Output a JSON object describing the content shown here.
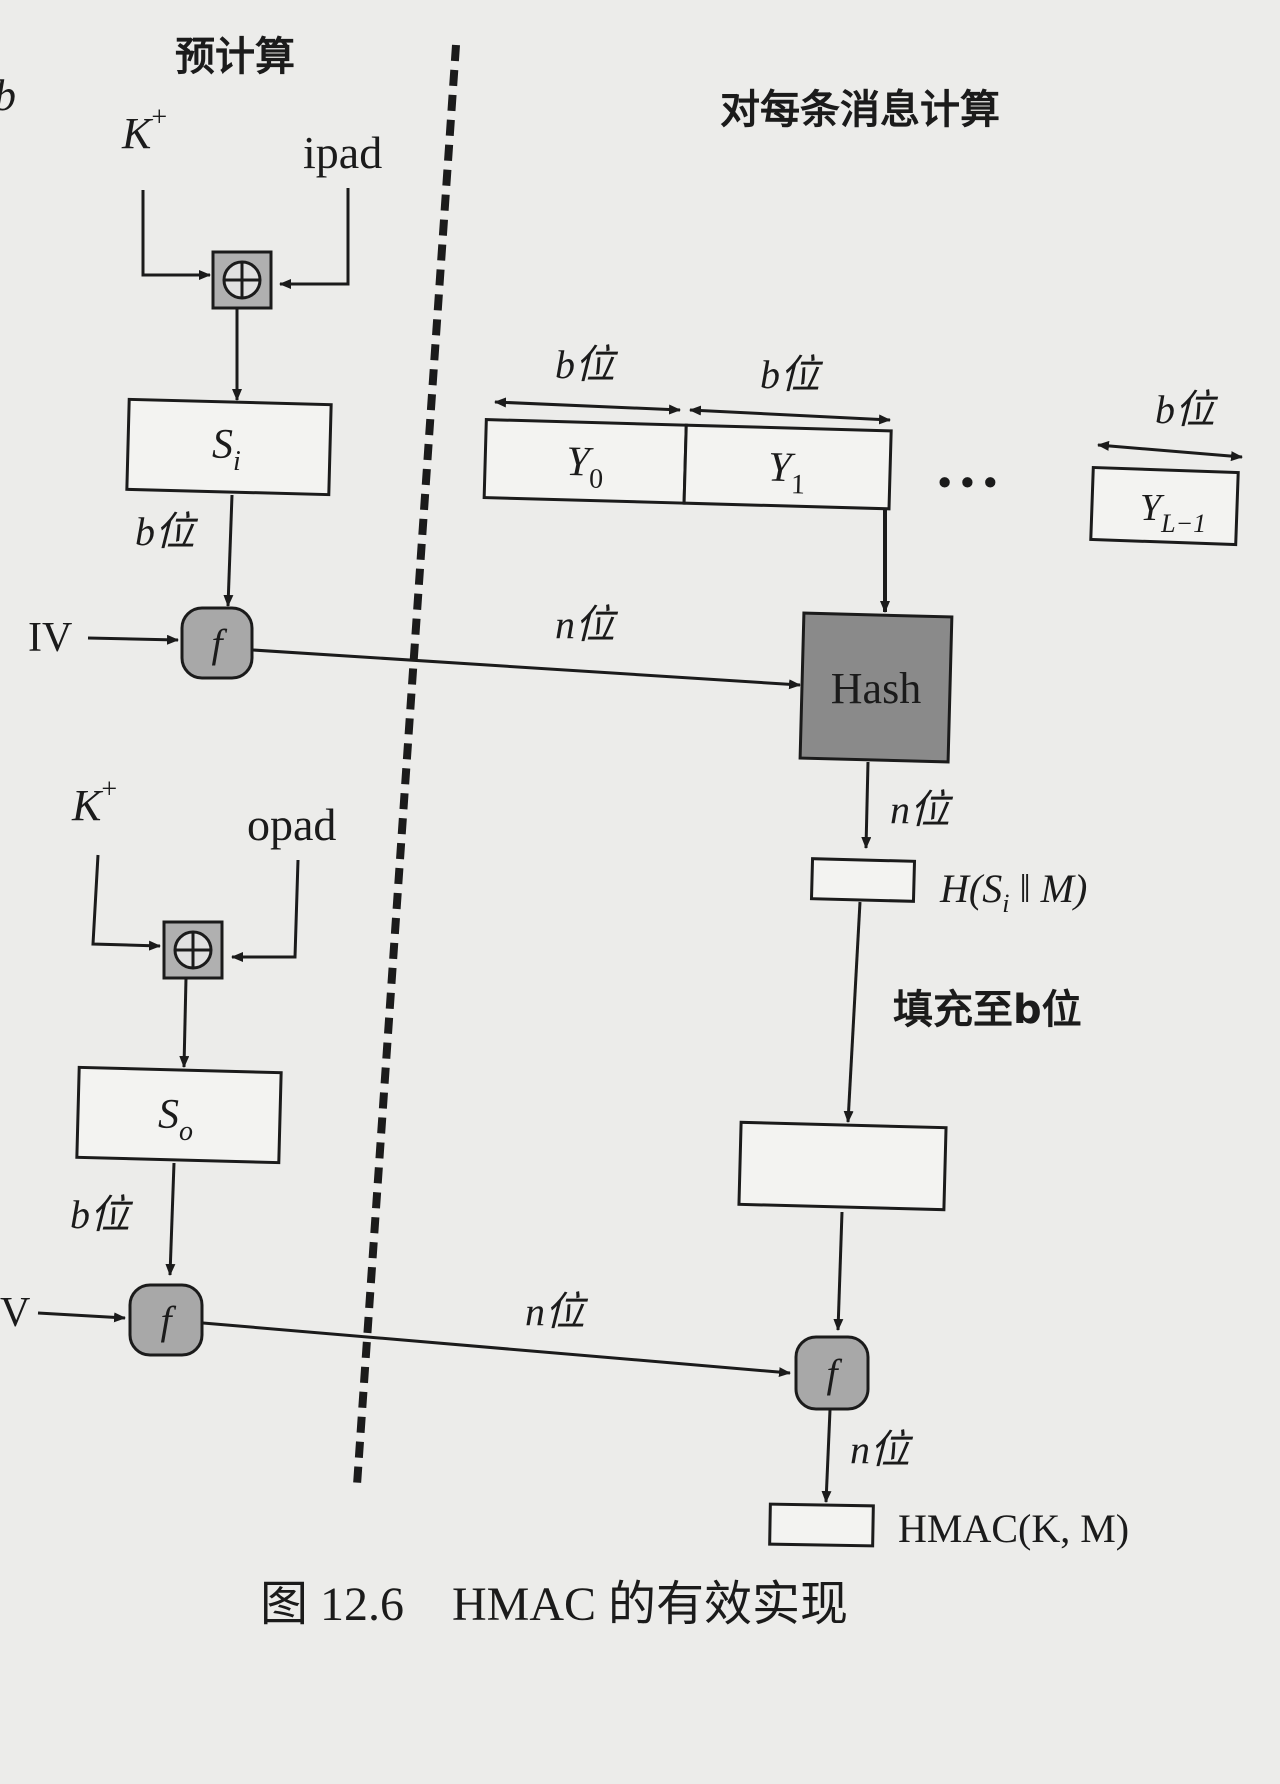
{
  "sections": {
    "precompute": "预计算",
    "per_message": "对每条消息计算"
  },
  "inputs": {
    "k_plus_top": "K",
    "k_plus_bottom": "K",
    "superscript_plus": "+",
    "ipad": "ipad",
    "opad": "opad",
    "iv_top": "IV",
    "iv_bottom": "V",
    "partial_left_letter": "b"
  },
  "blocks": {
    "s_i_main": "S",
    "s_i_sub": "i",
    "s_o_main": "S",
    "s_o_sub": "o",
    "y0_main": "Y",
    "y0_sub": "0",
    "y1_main": "Y",
    "y1_sub": "1",
    "yl_main": "Y",
    "yl_sub": "L−1",
    "ellipsis": "• • •",
    "hash": "Hash",
    "f": "f"
  },
  "labels": {
    "b_bits": "b位",
    "n_bits": "n位",
    "pad_to_b": "填充至b位",
    "hash_output": "H(S",
    "hash_output_sub": "i",
    "hash_output_rest": " ‖ M)",
    "hmac_output": "HMAC(K, M)"
  },
  "caption": {
    "number": "图 12.6",
    "text": "HMAC 的有效实现"
  },
  "colors": {
    "background": "#ececea",
    "line": "#1b1b1b",
    "hash_fill": "#8a8a8a",
    "node_fill": "#a8a8a8",
    "xor_fill": "#b0b0b0",
    "box_fill": "#f3f3f1"
  }
}
